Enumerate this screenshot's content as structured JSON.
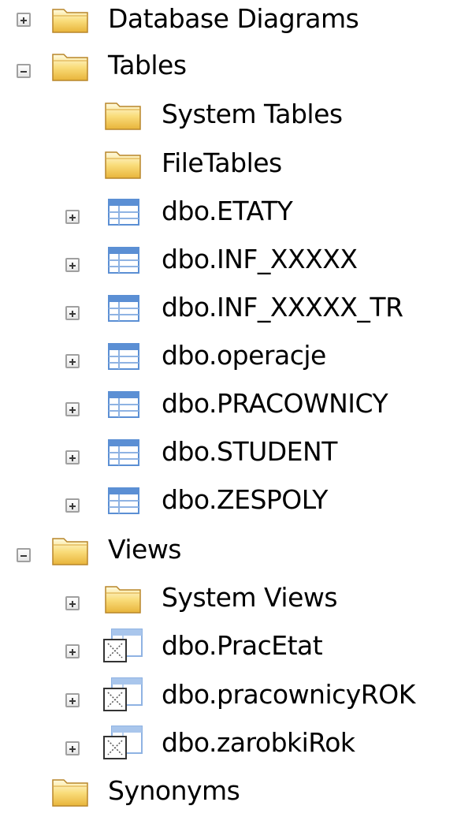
{
  "tree": {
    "database_diagrams": "Database Diagrams",
    "tables": "Tables",
    "system_tables": "System Tables",
    "file_tables": "FileTables",
    "table_items": [
      "dbo.ETATY",
      "dbo.INF_XXXXX",
      "dbo.INF_XXXXX_TR",
      "dbo.operacje",
      "dbo.PRACOWNICY",
      "dbo.STUDENT",
      "dbo.ZESPOLY"
    ],
    "views": "Views",
    "system_views": "System Views",
    "view_items": [
      "dbo.PracEtat",
      "dbo.pracownicyROK",
      "dbo.zarobkiRok"
    ],
    "synonyms": "Synonyms"
  },
  "colors": {
    "folder_light": "#fff4b8",
    "folder_dark": "#e8b43a",
    "table_blue": "#5b8fd4",
    "toggle_border": "#a0a0a0"
  },
  "icons": {
    "folder": "folder-icon",
    "table": "table-icon",
    "view": "view-icon",
    "expand": "expand-plus-icon",
    "collapse": "collapse-minus-icon"
  }
}
